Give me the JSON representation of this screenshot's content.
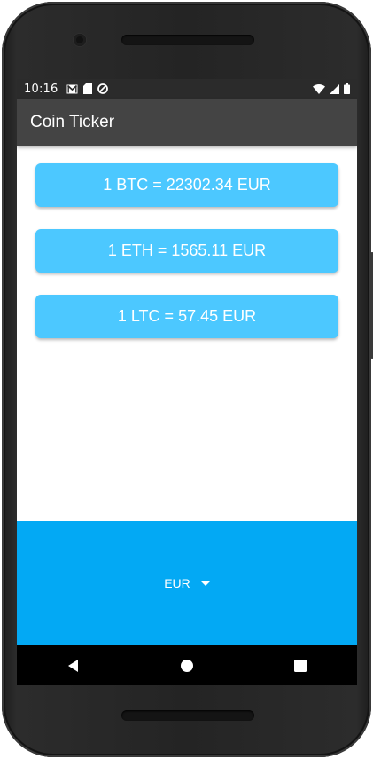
{
  "status_bar": {
    "time": "10:16",
    "left_icons": [
      "gmail-icon",
      "sd-card-icon",
      "sync-icon"
    ],
    "right_icons": [
      "wifi-icon",
      "cellular-signal-icon",
      "battery-icon"
    ]
  },
  "toolbar": {
    "title": "Coin Ticker"
  },
  "rates": [
    {
      "text": "1 BTC = 22302.34 EUR"
    },
    {
      "text": "1 ETH = 1565.11 EUR"
    },
    {
      "text": "1 LTC = 57.45 EUR"
    }
  ],
  "currency_selector": {
    "selected": "EUR"
  },
  "nav_bar": {
    "buttons": [
      "back-icon",
      "home-icon",
      "recents-icon"
    ]
  },
  "colors": {
    "toolbar": "#444444",
    "card": "#4cc8ff",
    "panel": "#03a9f4",
    "status_bar": "#2b2b2b"
  }
}
